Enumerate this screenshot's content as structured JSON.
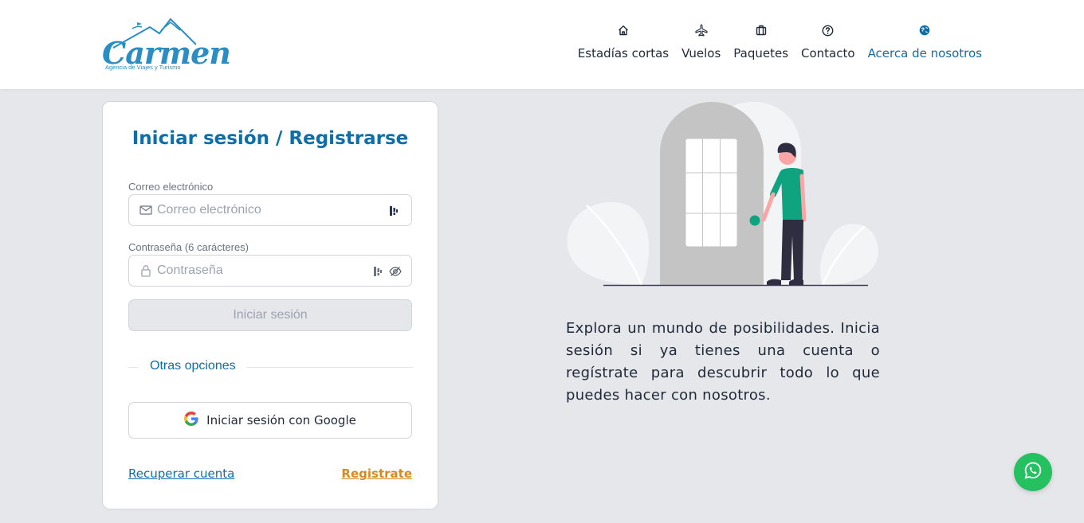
{
  "brand": {
    "name": "Carmen",
    "tagline": "Agencia de Viajes y Turismo",
    "color": "#2a8dc3"
  },
  "nav": {
    "items": [
      {
        "label": "Estadías cortas",
        "icon": "home-icon"
      },
      {
        "label": "Vuelos",
        "icon": "plane-icon"
      },
      {
        "label": "Paquetes",
        "icon": "luggage-icon"
      },
      {
        "label": "Contacto",
        "icon": "help-circle-icon"
      },
      {
        "label": "Acerca de nosotros",
        "icon": "globe-icon",
        "active": true
      }
    ]
  },
  "login": {
    "title": "Iniciar sesión / Registrarse",
    "email_label": "Correo electrónico",
    "email_placeholder": "Correo electrónico",
    "password_label": "Contraseña (6 carácteres)",
    "password_placeholder": "Contraseña",
    "submit_label": "Iniciar sesión",
    "other_options": "Otras opciones",
    "google_label": "Iniciar sesión con Google",
    "recover_label": "Recuperar cuenta",
    "register_label": "Registrate"
  },
  "hero": {
    "description": "Explora un mundo de posibilidades. Inicia sesión si ya tienes una cuenta o regístrate para descubrir todo lo que puedes hacer con nosotros."
  },
  "colors": {
    "primary": "#0e6ea8",
    "accent": "#d88a1f",
    "background": "#e5e7eb",
    "whatsapp": "#25c05f",
    "figure_shirt": "#10a37f"
  }
}
